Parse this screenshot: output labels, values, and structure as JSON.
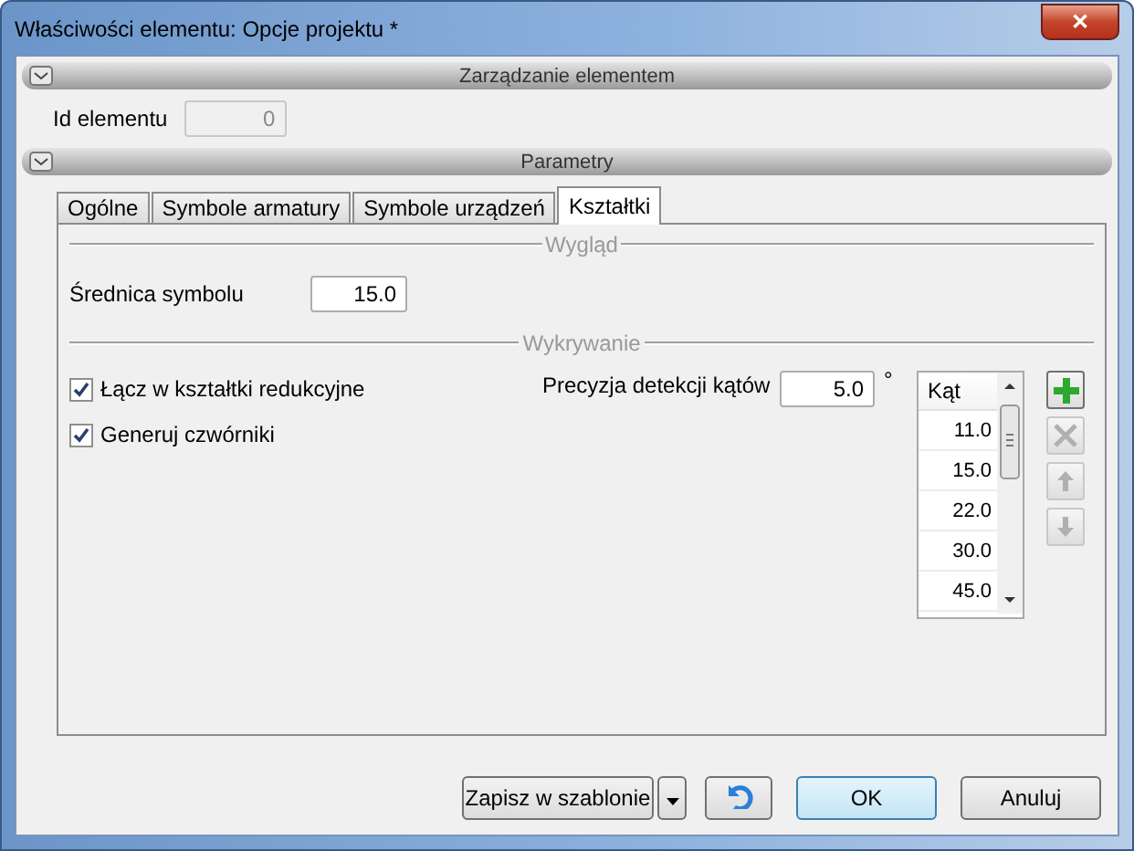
{
  "window": {
    "title": "Właściwości elementu: Opcje projektu *",
    "close": "✕"
  },
  "management": {
    "title": "Zarządzanie elementem",
    "expanded": true,
    "id_label": "Id elementu",
    "id_value": "0",
    "id_disabled": true
  },
  "parameters": {
    "title": "Parametry",
    "expanded": true
  },
  "tabs": [
    {
      "label": "Ogólne",
      "selected": false
    },
    {
      "label": "Symbole armatury",
      "selected": false
    },
    {
      "label": "Symbole urządzeń",
      "selected": false
    },
    {
      "label": "Kształtki",
      "selected": true
    }
  ],
  "appearance": {
    "title": "Wygląd",
    "diameter_label": "Średnica symbolu",
    "diameter_value": "15.0"
  },
  "detection": {
    "title": "Wykrywanie",
    "checkboxes": [
      {
        "label": "Łącz w kształtki redukcyjne",
        "checked": true
      },
      {
        "label": "Generuj czwórniki",
        "checked": true
      }
    ],
    "precision_label": "Precyzja detekcji kątów",
    "precision_value": "5.0",
    "precision_unit": "°",
    "angle_header": "Kąt",
    "angles": [
      "11.0",
      "15.0",
      "22.0",
      "30.0",
      "45.0"
    ],
    "tools": [
      {
        "kind": "add",
        "disabled": false
      },
      {
        "kind": "delete",
        "disabled": true
      },
      {
        "kind": "up",
        "disabled": true
      },
      {
        "kind": "down",
        "disabled": true
      }
    ]
  },
  "buttons": {
    "template": "Zapisz w szablonie",
    "ok": "OK",
    "cancel": "Anuluj"
  }
}
